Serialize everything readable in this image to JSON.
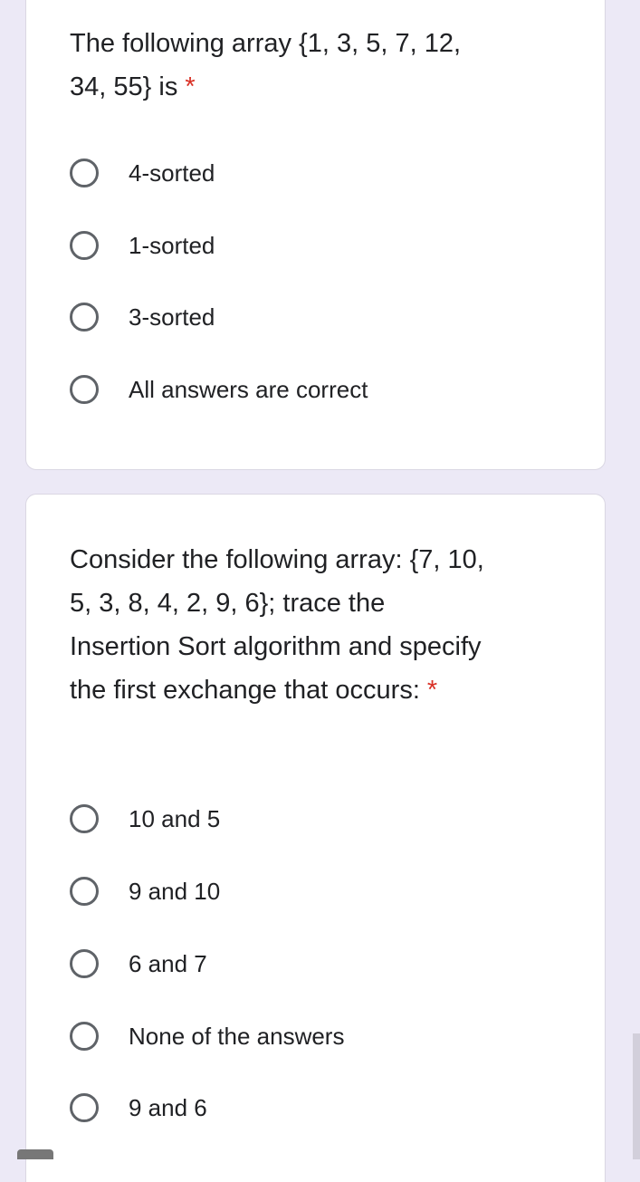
{
  "questions": [
    {
      "title": "The following array {1, 3, 5, 7, 12, 34, 55} is",
      "required_mark": "*",
      "options": [
        "4-sorted",
        "1-sorted",
        "3-sorted",
        "All answers are correct"
      ]
    },
    {
      "title": "Consider the following array: {7, 10, 5, 3, 8, 4, 2, 9, 6}; trace the Insertion Sort algorithm and specify the first exchange that occurs:",
      "required_mark": "*",
      "options": [
        "10 and 5",
        "9 and 10",
        "6 and 7",
        "None of the answers",
        "9 and 6"
      ]
    }
  ],
  "colors": {
    "background": "#ece9f6",
    "required": "#d93025",
    "radio": "#5f6368"
  }
}
